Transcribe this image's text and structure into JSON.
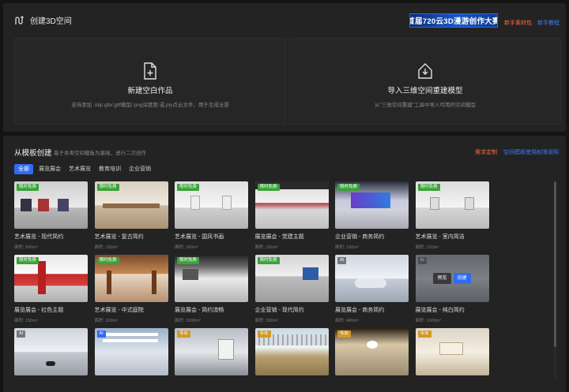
{
  "header": {
    "title": "创建3D空间",
    "banner": "首届720云3D漫游创作大赛",
    "link_materials": "新手素材包",
    "link_tutorial": "新手教程"
  },
  "create_cards": [
    {
      "title": "新建空白作品",
      "desc": "支持添加 .obj/.glb/.gltf模型/.png深度图 或.ply点云文件，用于生成全景"
    },
    {
      "title": "导入三维空间重建模型",
      "desc": "从\"三维空间重建\"工具中导入可用的空间模型"
    }
  ],
  "templates_section": {
    "title": "从模板创建",
    "subtitle": "基于各类空间模板为基础，进行二次创作",
    "link_custom": "需求定制",
    "link_usage": "空间模板使用权限说明",
    "tabs": [
      "全部",
      "展览展会",
      "艺术展览",
      "教育培训",
      "企业营销"
    ],
    "active_tab": 0
  },
  "templates": [
    {
      "title": "艺术展览 - 现代简约",
      "area": "面积: 500m²",
      "badge": "限时免费",
      "badge_color": "green"
    },
    {
      "title": "艺术展览 - 复古简约",
      "area": "面积: 150m²",
      "badge": "限时免费",
      "badge_color": "green"
    },
    {
      "title": "艺术展览 - 国风书画",
      "area": "面积: 200m²",
      "badge": "限时免费",
      "badge_color": "green"
    },
    {
      "title": "展览展会 - 党建主题",
      "area": "面积: 260m²",
      "badge": "限时免费",
      "badge_color": "green"
    },
    {
      "title": "企业营销 - 商务简约",
      "area": "面积: 150m²",
      "badge": "限时免费",
      "badge_color": "green"
    },
    {
      "title": "艺术展览 - 室内简洁",
      "area": "面积: 120m²",
      "badge": "限时免费",
      "badge_color": "green"
    },
    {
      "title": "展览展会 - 红色主题",
      "area": "面积: 150m²",
      "badge": "限时免费",
      "badge_color": "green"
    },
    {
      "title": "艺术展览 - 中式庭院",
      "area": "面积: 200m²",
      "badge": "限时免费",
      "badge_color": "green"
    },
    {
      "title": "展览展会 - 简约流畅",
      "area": "面积: 1000m²",
      "badge": "限时免费",
      "badge_color": "green"
    },
    {
      "title": "企业营销 - 现代简约",
      "area": "面积: 360m²",
      "badge": "限时免费",
      "badge_color": "green"
    },
    {
      "title": "展览展会 - 商务简约",
      "area": "面积: 480m²",
      "badge": "AI",
      "badge_color": "gray"
    },
    {
      "title": "展览展会 - 纯白简约",
      "area": "面积: 1000m²",
      "badge": "AI",
      "badge_color": "gray",
      "hover": {
        "preview": "预览",
        "create": "创建"
      }
    },
    {
      "title": "",
      "area": "",
      "badge": "AI",
      "badge_color": "gray"
    },
    {
      "title": "",
      "area": "",
      "badge": "AI",
      "badge_color": "blue"
    },
    {
      "title": "",
      "area": "",
      "badge": "专业",
      "badge_color": "orange"
    },
    {
      "title": "",
      "area": "",
      "badge": "专业",
      "badge_color": "orange"
    },
    {
      "title": "",
      "area": "",
      "badge": "专业",
      "badge_color": "orange"
    },
    {
      "title": "",
      "area": "",
      "badge": "专业",
      "badge_color": "orange"
    }
  ]
}
